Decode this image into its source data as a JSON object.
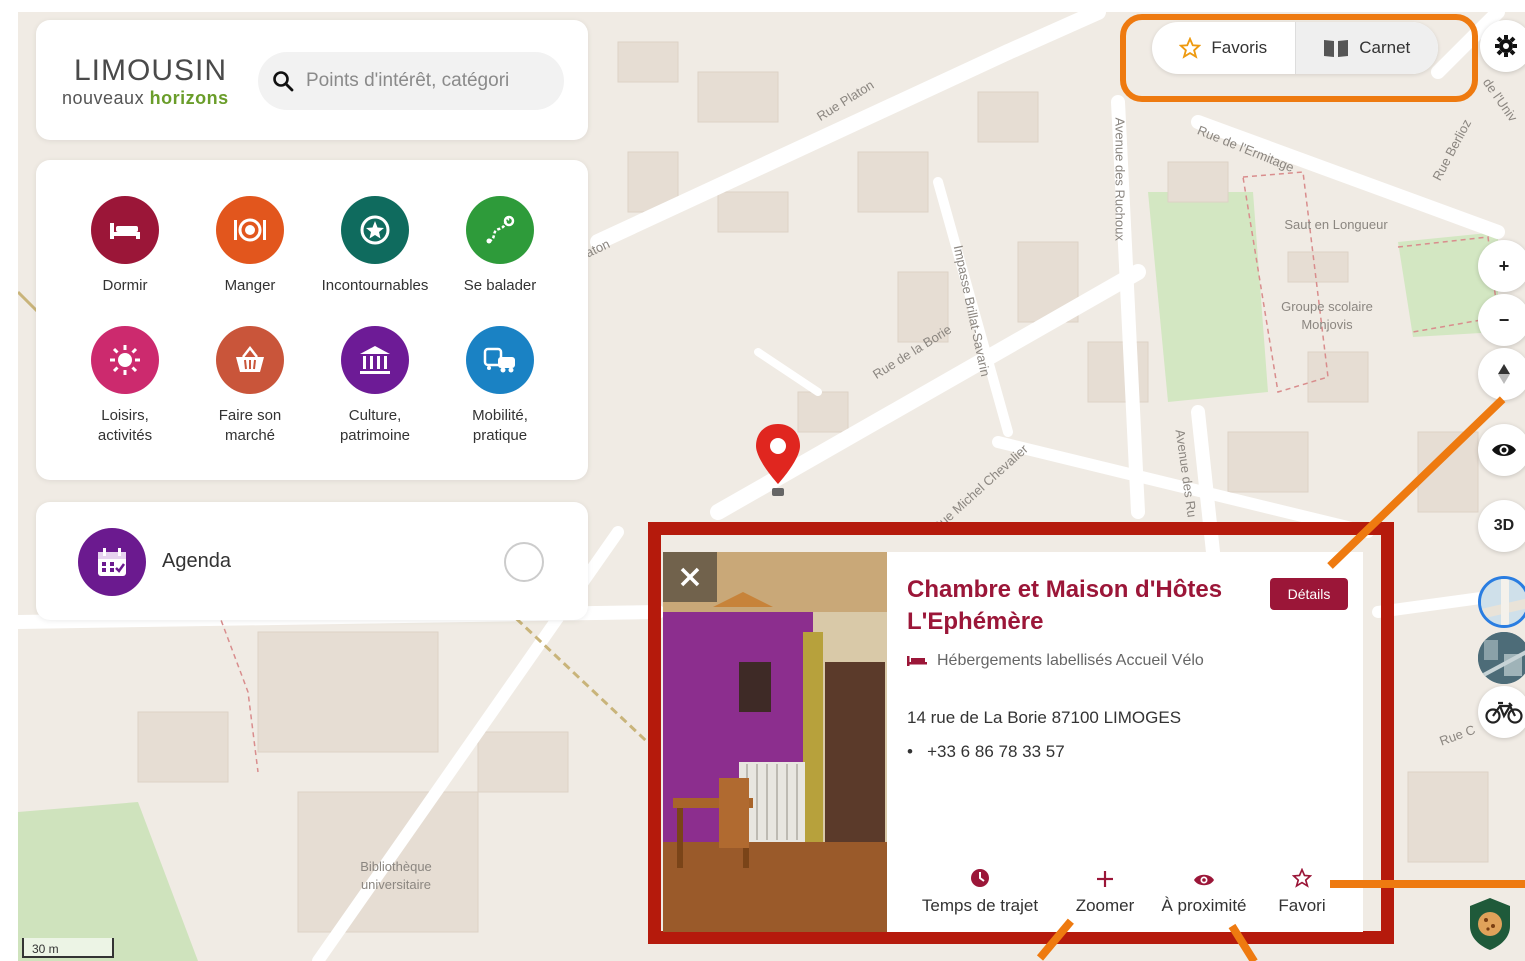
{
  "brand": {
    "logo_top": "LIMOUSIN",
    "logo_bottom_a": "nouveaux",
    "logo_bottom_b": "horizons"
  },
  "search": {
    "placeholder": "Points d'intérêt, catégori"
  },
  "categories": [
    {
      "label_1": "Dormir",
      "label_2": "",
      "color": "#9b1638",
      "icon": "bed-icon"
    },
    {
      "label_1": "Manger",
      "label_2": "",
      "color": "#e2561d",
      "icon": "plate-icon"
    },
    {
      "label_1": "Incontournables",
      "label_2": "",
      "color": "#0f6b5e",
      "icon": "star-badge-icon"
    },
    {
      "label_1": "Se balader",
      "label_2": "",
      "color": "#2e9b3a",
      "icon": "route-icon"
    },
    {
      "label_1": "Loisirs,",
      "label_2": "activités",
      "color": "#cc2a6e",
      "icon": "sun-icon"
    },
    {
      "label_1": "Faire son",
      "label_2": "marché",
      "color": "#c9553a",
      "icon": "basket-icon"
    },
    {
      "label_1": "Culture,",
      "label_2": "patrimoine",
      "color": "#6d1b96",
      "icon": "museum-icon"
    },
    {
      "label_1": "Mobilité,",
      "label_2": "pratique",
      "color": "#1a82c4",
      "icon": "vehicles-icon"
    }
  ],
  "agenda": {
    "label": "Agenda"
  },
  "toolbar": {
    "favoris": "Favoris",
    "carnet": "Carnet"
  },
  "map_controls": {
    "zoom_in": "+",
    "zoom_out": "−",
    "btn_3d": "3D"
  },
  "map_labels": {
    "rue_platon": "Rue Platon",
    "rue_ermitage": "Rue de l'Ermitage",
    "rue_berlioz": "Rue Berlioz",
    "avenue_ruchoux": "Avenue des Ruchoux",
    "impasse_brillat": "Impasse Brillat-Savarin",
    "rue_borie": "Rue de la Borie",
    "rue_chevalier": "Rue Michel Chevalier",
    "avenue_ruchoux_2": "Avenue des Ru",
    "saut_longueur": "Saut en Longueur",
    "groupe_scolaire_1": "Groupe scolaire",
    "groupe_scolaire_2": "Monjovis",
    "bibliotheque_1": "Bibliothèque",
    "bibliotheque_2": "universitaire",
    "platon_short": "aton",
    "rue_short": "Rue C",
    "univ_short": "de l'Univ"
  },
  "popup": {
    "title": "Chambre et Maison d'Hôtes L'Ephémère",
    "details": "Détails",
    "category": "Hébergements labellisés Accueil Vélo",
    "address": "14 rue de La Borie 87100 LIMOGES",
    "phone": "+33 6 86 78 33 57",
    "actions": [
      "Temps de trajet",
      "Zoomer",
      "À proximité",
      "Favori"
    ]
  },
  "scale": "30 m",
  "colors": {
    "accent": "#9b1638",
    "highlight_orange": "#ee7a10",
    "highlight_red": "#b51a0c",
    "map_bg": "#f0ebe4"
  }
}
